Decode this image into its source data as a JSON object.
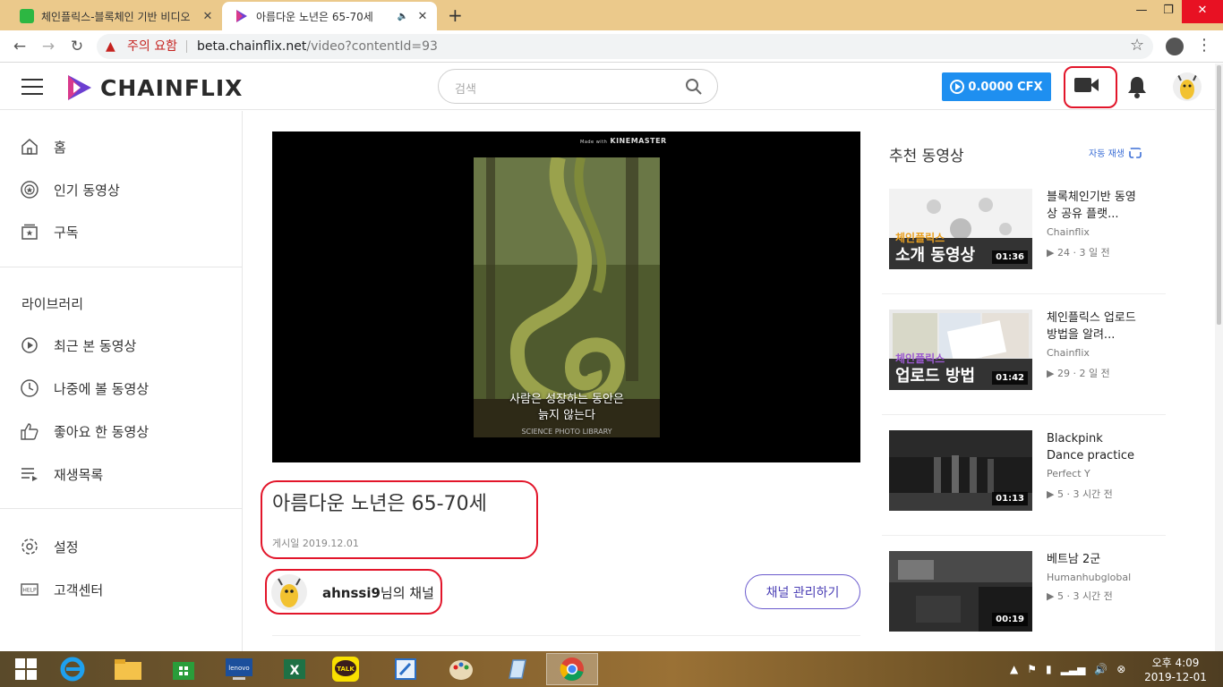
{
  "browser": {
    "tabs": [
      {
        "title": "체인플릭스-블록체인 기반 비디오",
        "close": "✕"
      },
      {
        "title": "아름다운 노년은 65-70세",
        "close": "✕",
        "audio": "🔈"
      }
    ],
    "new_tab": "+",
    "window_controls": {
      "minimize": "—",
      "maximize": "❐",
      "close": "✕"
    },
    "nav": {
      "back": "←",
      "forward": "→",
      "reload": "↻"
    },
    "security_warning": "주의 요함",
    "url_host": "beta.chainflix.net",
    "url_path": "/video?contentId=93",
    "bookmark": "☆",
    "menu": "⋮"
  },
  "header": {
    "logo": "CHAINFLIX",
    "search_placeholder": "검색",
    "cfx_balance": "0.0000 CFX",
    "icons": [
      "menu-icon",
      "search-icon",
      "video-camera-icon",
      "bell-icon",
      "avatar"
    ]
  },
  "sidebar": {
    "main_items": [
      {
        "label": "홈",
        "icon": "home-icon"
      },
      {
        "label": "인기 동영상",
        "icon": "popular-icon"
      },
      {
        "label": "구독",
        "icon": "subscription-icon"
      }
    ],
    "library_heading": "라이브러리",
    "library_items": [
      {
        "label": "최근 본 동영상",
        "icon": "history-icon"
      },
      {
        "label": "나중에 볼 동영상",
        "icon": "clock-icon"
      },
      {
        "label": "좋아요 한 동영상",
        "icon": "thumbs-up-icon"
      },
      {
        "label": "재생목록",
        "icon": "playlist-icon"
      }
    ],
    "bottom_items": [
      {
        "label": "설정",
        "icon": "gear-icon"
      },
      {
        "label": "고객센터",
        "icon": "help-icon",
        "badge": "HELP"
      }
    ]
  },
  "video": {
    "watermark_small": "Made with",
    "watermark": "KINEMASTER",
    "subtitle_line1": "사람은 성장하는 동안은",
    "subtitle_line2": "늙지 않는다",
    "credit": "SCIENCE PHOTO LIBRARY",
    "title": "아름다운 노년은 65-70세",
    "posted": "게시일 2019.12.01",
    "channel_user": "ahnssi9",
    "channel_suffix": "님의 채널",
    "manage_channel": "채널 관리하기"
  },
  "recommended": {
    "heading": "추천 동영상",
    "autoplay": "자동 재생",
    "items": [
      {
        "title": "블록체인기반 동영상 공유 플랫...",
        "channel": "Chainflix",
        "meta": "▶ 24 · 3 일 전",
        "duration": "01:36",
        "overlay_small": "체인플릭스",
        "overlay_big": "소개 동영상"
      },
      {
        "title": "체인플릭스 업로드 방법을 알려...",
        "channel": "Chainflix",
        "meta": "▶ 29 · 2 일 전",
        "duration": "01:42",
        "overlay_small": "체인플릭스",
        "overlay_big": "업로드 방법"
      },
      {
        "title": "Blackpink Dance practice",
        "channel": "Perfect Y",
        "meta": "▶ 5 · 3 시간 전",
        "duration": "01:13"
      },
      {
        "title": "베트남 2군",
        "channel": "Humanhubglobal",
        "meta": "▶ 5 · 3 시간 전",
        "duration": "00:19"
      }
    ]
  },
  "taskbar": {
    "apps": [
      "windows-start",
      "internet-explorer",
      "file-explorer",
      "store",
      "lenovo",
      "excel",
      "kakaotalk",
      "editor",
      "paint",
      "notes",
      "chrome"
    ],
    "kakao_label": "TALK",
    "lenovo_label": "lenovo",
    "tray": [
      "▲",
      "⚑",
      "▮",
      "▂▃▅",
      "🔊"
    ],
    "time": "오후 4:09",
    "date": "2019-12-01"
  },
  "colors": {
    "accent": "#1e8ff0",
    "highlight": "#e2152a",
    "channel_btn": "#6a5acd"
  }
}
